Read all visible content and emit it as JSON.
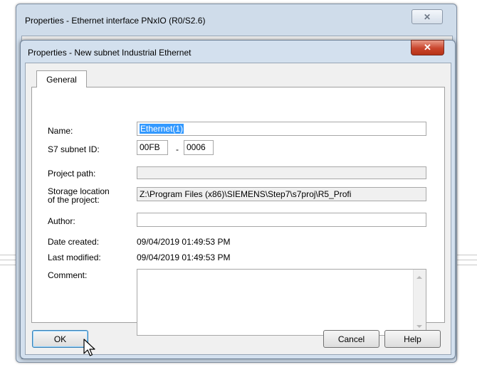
{
  "outer_dialog": {
    "title": "Properties - Ethernet interface  PNxIO (R0/S2.6)",
    "close_glyph": "✕"
  },
  "inner_dialog": {
    "title": "Properties -  New subnet Industrial Ethernet",
    "close_glyph": "✕"
  },
  "tabs": [
    {
      "label": "General",
      "active": true
    }
  ],
  "form": {
    "name_label": "Name:",
    "name_value": "Ethernet(1)",
    "subnet_label": "S7 subnet ID:",
    "subnet_id_1": "00FB",
    "subnet_sep": "-",
    "subnet_id_2": "0006",
    "project_path_label": "Project path:",
    "project_path_value": "",
    "storage_label_1": "Storage location",
    "storage_label_2": "of the project:",
    "storage_value": "Z:\\Program Files (x86)\\SIEMENS\\Step7\\s7proj\\R5_Profi",
    "author_label": "Author:",
    "author_value": "",
    "date_created_label": "Date created:",
    "date_created_value": "09/04/2019 01:49:53 PM",
    "last_modified_label": "Last modified:",
    "last_modified_value": "09/04/2019 01:49:53 PM",
    "comment_label": "Comment:",
    "comment_value": ""
  },
  "buttons": {
    "ok": "OK",
    "cancel": "Cancel",
    "help": "Help"
  },
  "colors": {
    "selection": "#3399ff",
    "title_bar": "#d3e0ee",
    "close_red": "#c9452d"
  }
}
